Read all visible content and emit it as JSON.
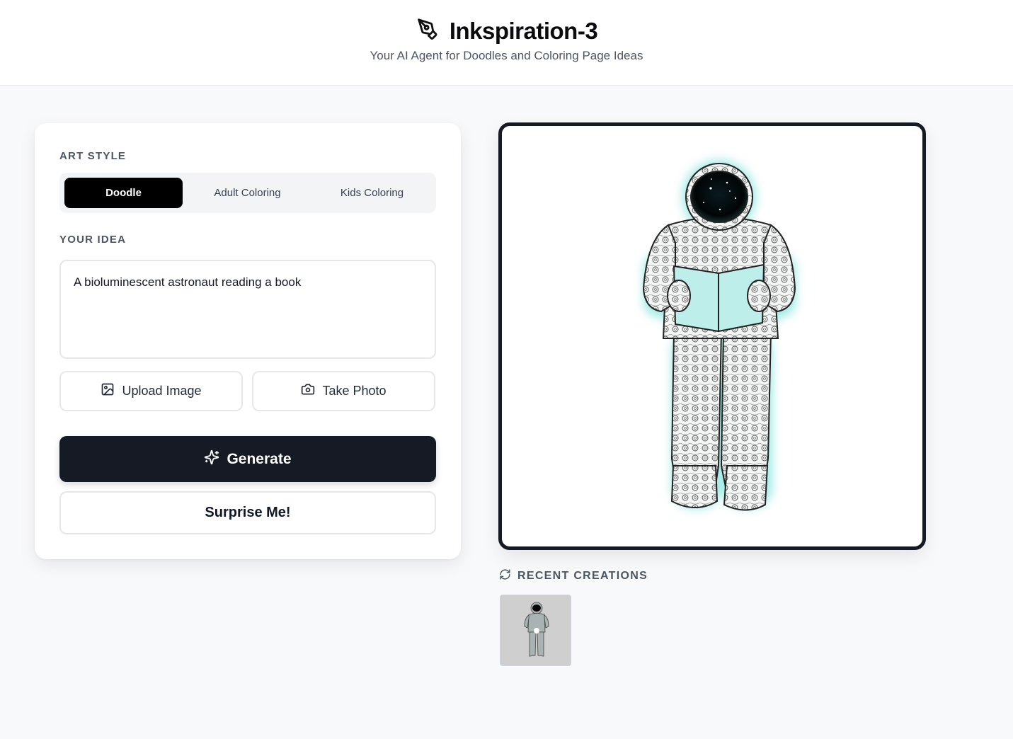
{
  "header": {
    "title": "Inkspiration-3",
    "tagline": "Your AI Agent for Doodles and Coloring Page Ideas",
    "logo_icon": "pen-tool-icon"
  },
  "controls": {
    "art_style_label": "ART STYLE",
    "styles": [
      {
        "label": "Doodle",
        "active": true
      },
      {
        "label": "Adult Coloring",
        "active": false
      },
      {
        "label": "Kids Coloring",
        "active": false
      }
    ],
    "idea_label": "YOUR IDEA",
    "idea_value": "A bioluminescent astronaut reading a book",
    "upload_label": "Upload Image",
    "upload_icon": "image-icon",
    "photo_label": "Take Photo",
    "photo_icon": "camera-icon",
    "generate_label": "Generate",
    "generate_icon": "sparkles-icon",
    "surprise_label": "Surprise Me!"
  },
  "preview": {
    "recent_label": "RECENT CREATIONS",
    "recent_icon": "refresh-icon",
    "accent_glow": "#7fe3dc",
    "thumbnails": 1
  }
}
